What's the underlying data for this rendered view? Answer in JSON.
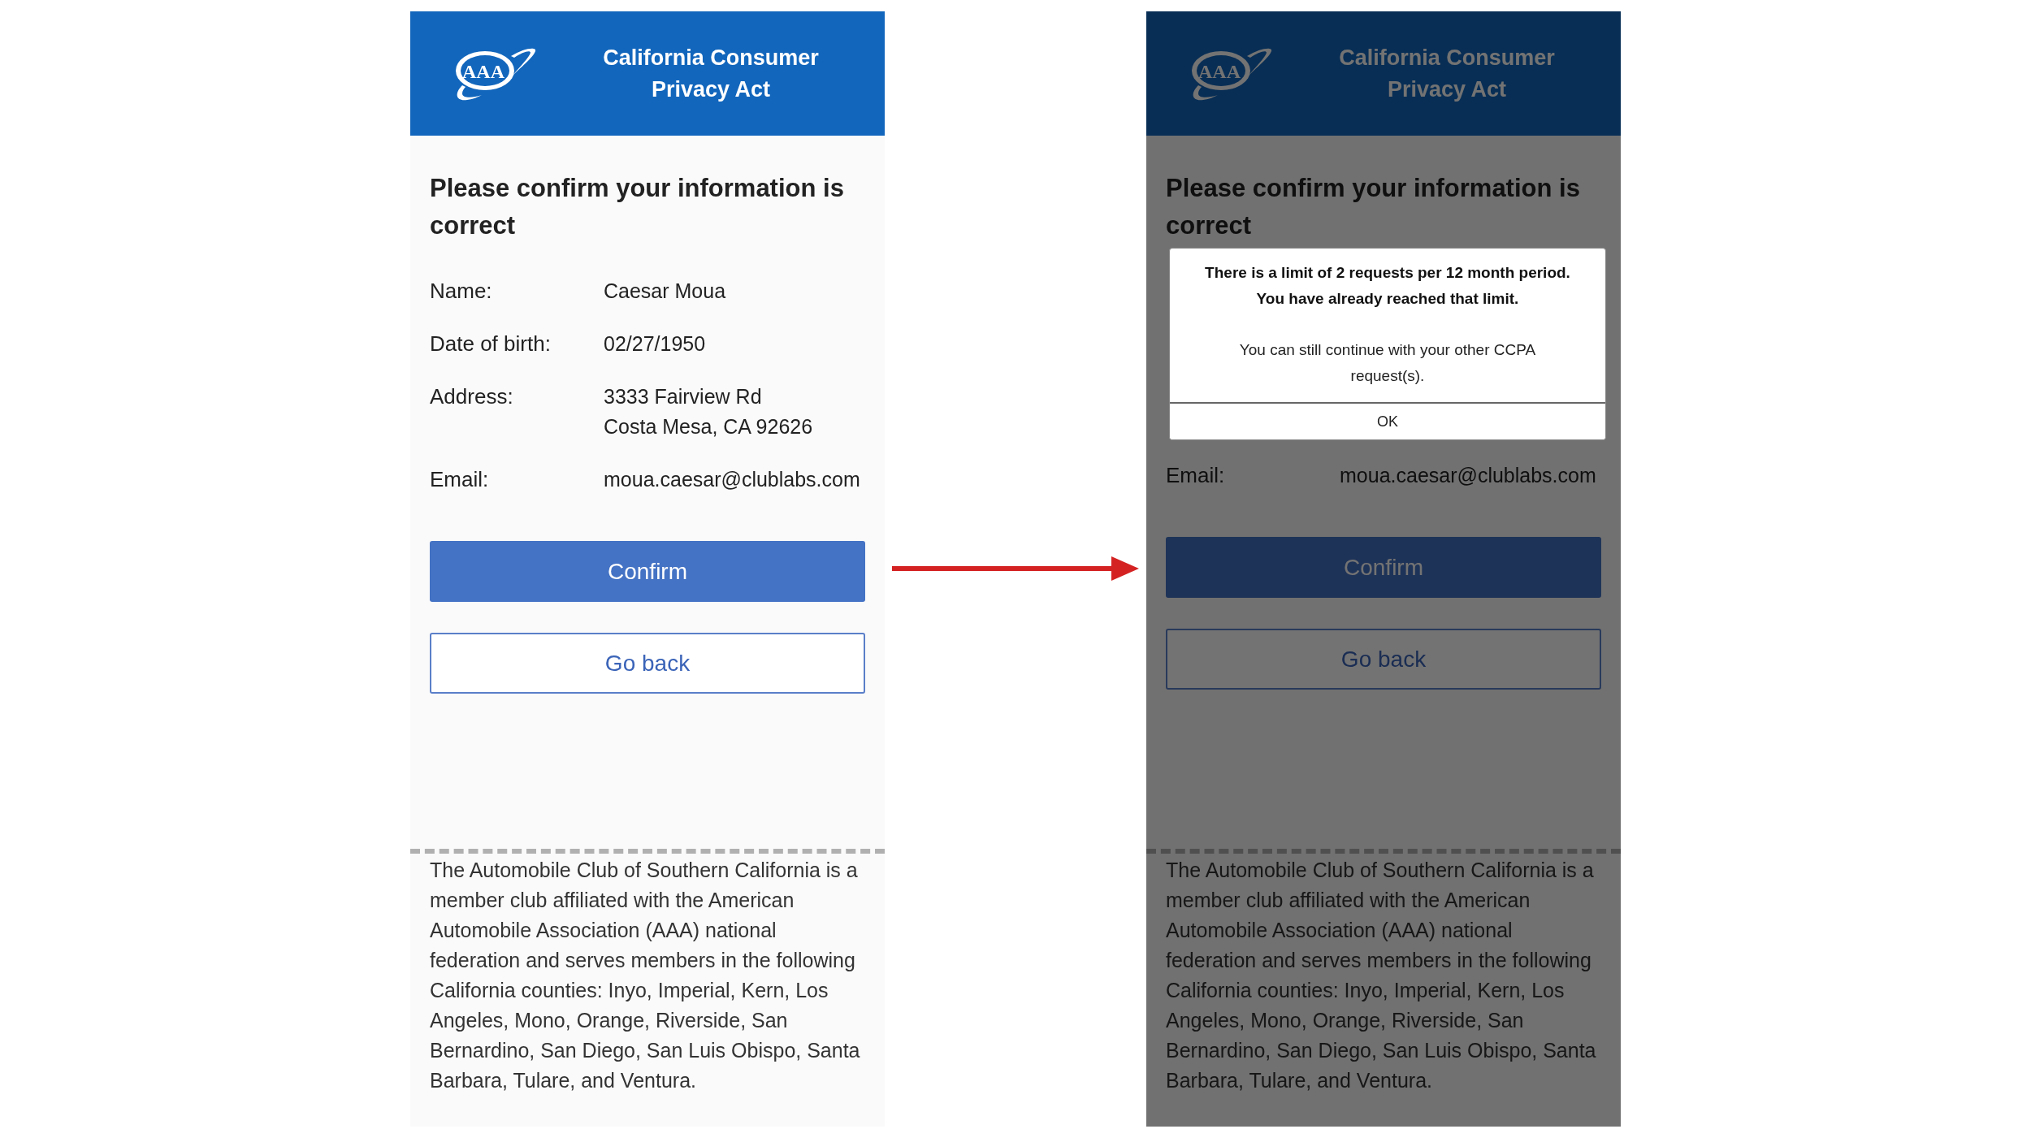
{
  "screens": [
    {
      "dimmed": false,
      "header": {
        "logo_text": "AAA",
        "title": "California Consumer Privacy Act"
      },
      "heading": "Please confirm your information is correct",
      "fields": [
        {
          "label": "Name:",
          "lines": [
            "Caesar Moua"
          ]
        },
        {
          "label": "Date of birth:",
          "lines": [
            "02/27/1950"
          ]
        },
        {
          "label": "Address:",
          "lines": [
            "3333 Fairview Rd",
            "Costa Mesa, CA 92626"
          ]
        },
        {
          "label": "Email:",
          "lines": [
            "moua.caesar@clublabs.com"
          ]
        }
      ],
      "confirm_button": "Confirm",
      "back_button": "Go back",
      "footer": "The Automobile Club of Southern California is a member club affiliated with the American Automobile Association (AAA) national federation and serves members in the following California counties: Inyo, Imperial, Kern, Los Angeles, Mono, Orange, Riverside, San Bernardino, San Diego, San Luis Obispo, Santa Barbara, Tulare, and Ventura."
    },
    {
      "dimmed": true,
      "header": {
        "logo_text": "AAA",
        "title": "California Consumer Privacy Act"
      },
      "heading": "Please confirm your information is correct",
      "dialog": {
        "message": [
          "There is a limit of 2 requests per 12 month period.",
          "You have already reached that limit."
        ],
        "note": "You can still continue with your other CCPA request(s).",
        "ok_button": "OK"
      },
      "fields": [
        {
          "label": "Email:",
          "lines": [
            "moua.caesar@clublabs.com"
          ]
        }
      ],
      "confirm_button": "Confirm",
      "back_button": "Go back",
      "footer": "The Automobile Club of Southern California is a member club affiliated with the American Automobile Association (AAA) national federation and serves members in the following California counties: Inyo, Imperial, Kern, Los Angeles, Mono, Orange, Riverside, San Bernardino, San Diego, San Luis Obispo, Santa Barbara, Tulare, and Ventura."
    }
  ]
}
